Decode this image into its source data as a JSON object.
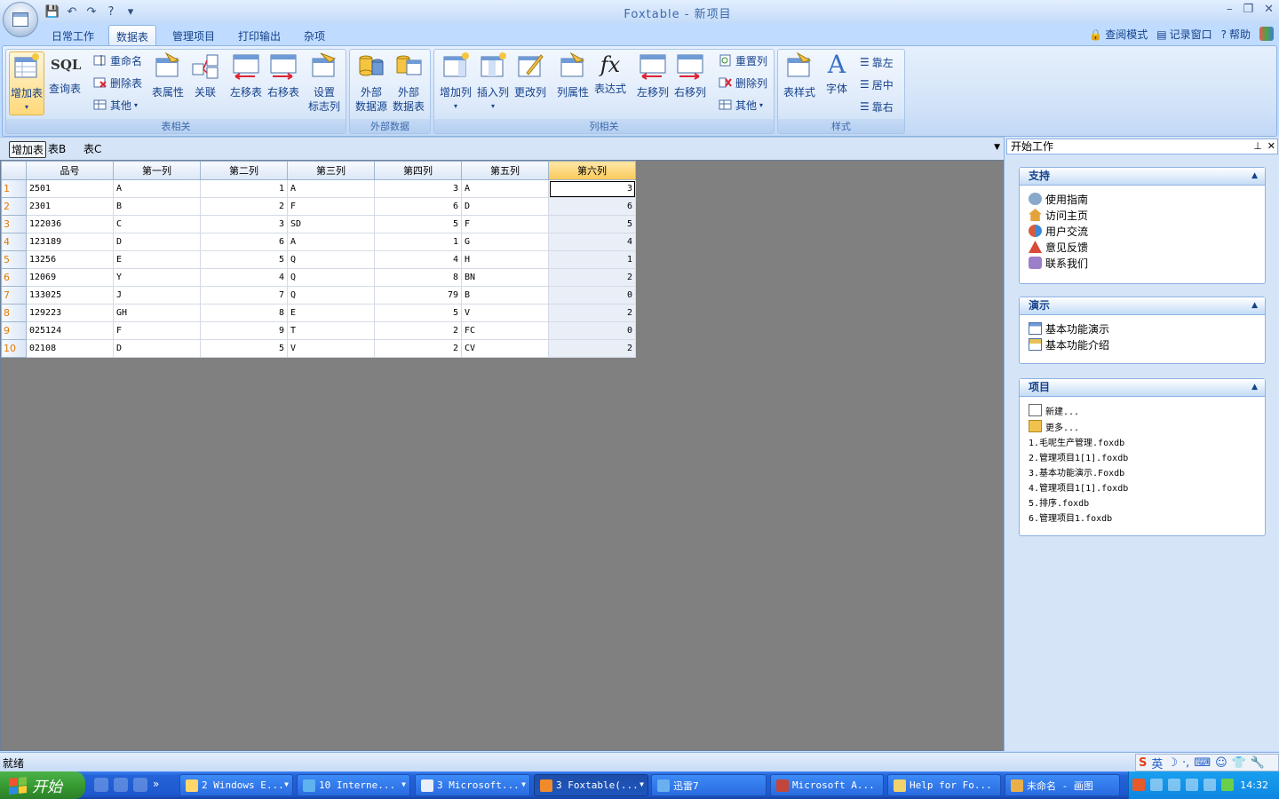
{
  "window": {
    "title": "Foxtable - 新项目",
    "controls": [
      "–",
      "❐",
      "✕"
    ]
  },
  "ribbon_tabs": [
    {
      "label": "日常工作",
      "active": false
    },
    {
      "label": "数据表",
      "active": true
    },
    {
      "label": "管理项目",
      "active": false
    },
    {
      "label": "打印输出",
      "active": false
    },
    {
      "label": "杂项",
      "active": false
    }
  ],
  "right_links": {
    "view_mode": "查阅模式",
    "log_window": "记录窗口",
    "help": "帮助"
  },
  "ribbon": {
    "table_group": {
      "label": "表相关",
      "add_table": "增加表",
      "query_table": "查询表",
      "sql_icon_text": "SQL",
      "rename": "重命名",
      "delete_table": "删除表",
      "other": "其他",
      "table_props": "表属性",
      "relation": "关联",
      "move_left": "左移表",
      "move_right": "右移表",
      "set_flag_1": "设置",
      "set_flag_2": "标志列"
    },
    "external_group": {
      "label": "外部数据",
      "ext_source_1": "外部",
      "ext_source_2": "数据源",
      "ext_table_1": "外部",
      "ext_table_2": "数据表"
    },
    "column_group": {
      "label": "列相关",
      "add_col": "增加列",
      "insert_col": "插入列",
      "rename_col": "更改列",
      "col_props": "列属性",
      "expression": "表达式",
      "fx_icon_text": "fx",
      "move_col_left": "左移列",
      "move_col_right": "右移列",
      "reset_col": "重置列",
      "delete_col": "删除列",
      "other": "其他"
    },
    "style_group": {
      "label": "样式",
      "table_style": "表样式",
      "font": "字体",
      "font_icon_text": "A",
      "align_left": "靠左",
      "align_center": "居中",
      "align_right": "靠右"
    }
  },
  "sheet_tabs": [
    {
      "label": "增加表",
      "active": true
    },
    {
      "label": "表B",
      "active": false
    },
    {
      "label": "表C",
      "active": false
    }
  ],
  "grid": {
    "columns": [
      "品号",
      "第一列",
      "第二列",
      "第三列",
      "第四列",
      "第五列",
      "第六列"
    ],
    "rows": [
      [
        "1",
        "2501",
        "A",
        "1",
        "A",
        "3",
        "A",
        "3"
      ],
      [
        "2",
        "2301",
        "B",
        "2",
        "F",
        "6",
        "D",
        "6"
      ],
      [
        "3",
        "122036",
        "C",
        "3",
        "SD",
        "5",
        "F",
        "5"
      ],
      [
        "4",
        "123189",
        "D",
        "6",
        "A",
        "1",
        "G",
        "4"
      ],
      [
        "5",
        "13256",
        "E",
        "5",
        "Q",
        "4",
        "H",
        "1"
      ],
      [
        "6",
        "12069",
        "Y",
        "4",
        "Q",
        "8",
        "BN",
        "2"
      ],
      [
        "7",
        "133025",
        "J",
        "7",
        "Q",
        "79",
        "B",
        "0"
      ],
      [
        "8",
        "129223",
        "GH",
        "8",
        "E",
        "5",
        "V",
        "2"
      ],
      [
        "9",
        "025124",
        "F",
        "9",
        "T",
        "2",
        "FC",
        "0"
      ],
      [
        "10",
        "02108",
        "D",
        "5",
        "V",
        "2",
        "CV",
        "2"
      ]
    ]
  },
  "task_pane": {
    "title": "开始工作",
    "pin": "⊥",
    "close": "✕",
    "support": {
      "title": "支持",
      "items": [
        "使用指南",
        "访问主页",
        "用户交流",
        "意见反馈",
        "联系我们"
      ]
    },
    "demo": {
      "title": "演示",
      "items": [
        "基本功能演示",
        "基本功能介绍"
      ]
    },
    "project": {
      "title": "项目",
      "items": [
        "新建...",
        "更多..."
      ],
      "recent": [
        "1.毛呢生产管理.foxdb",
        "2.管理项目1[1].foxdb",
        "3.基本功能演示.Foxdb",
        "4.管理项目1[1].foxdb",
        "5.排序.foxdb",
        "6.管理项目1.foxdb"
      ]
    }
  },
  "status": {
    "text": "就绪",
    "ime_label": "英"
  },
  "taskbar": {
    "start_label": "开始",
    "buttons": [
      {
        "label": "2 Windows E...",
        "active": false
      },
      {
        "label": "10 Interne...",
        "active": false
      },
      {
        "label": "3 Microsoft...",
        "active": false
      },
      {
        "label": "3 Foxtable(...",
        "active": true
      },
      {
        "label": "迅雷7",
        "active": false
      },
      {
        "label": "Microsoft A...",
        "active": false
      },
      {
        "label": "Help for Fo...",
        "active": false
      },
      {
        "label": "未命名 - 画图",
        "active": false
      }
    ],
    "clock": "14:32"
  }
}
